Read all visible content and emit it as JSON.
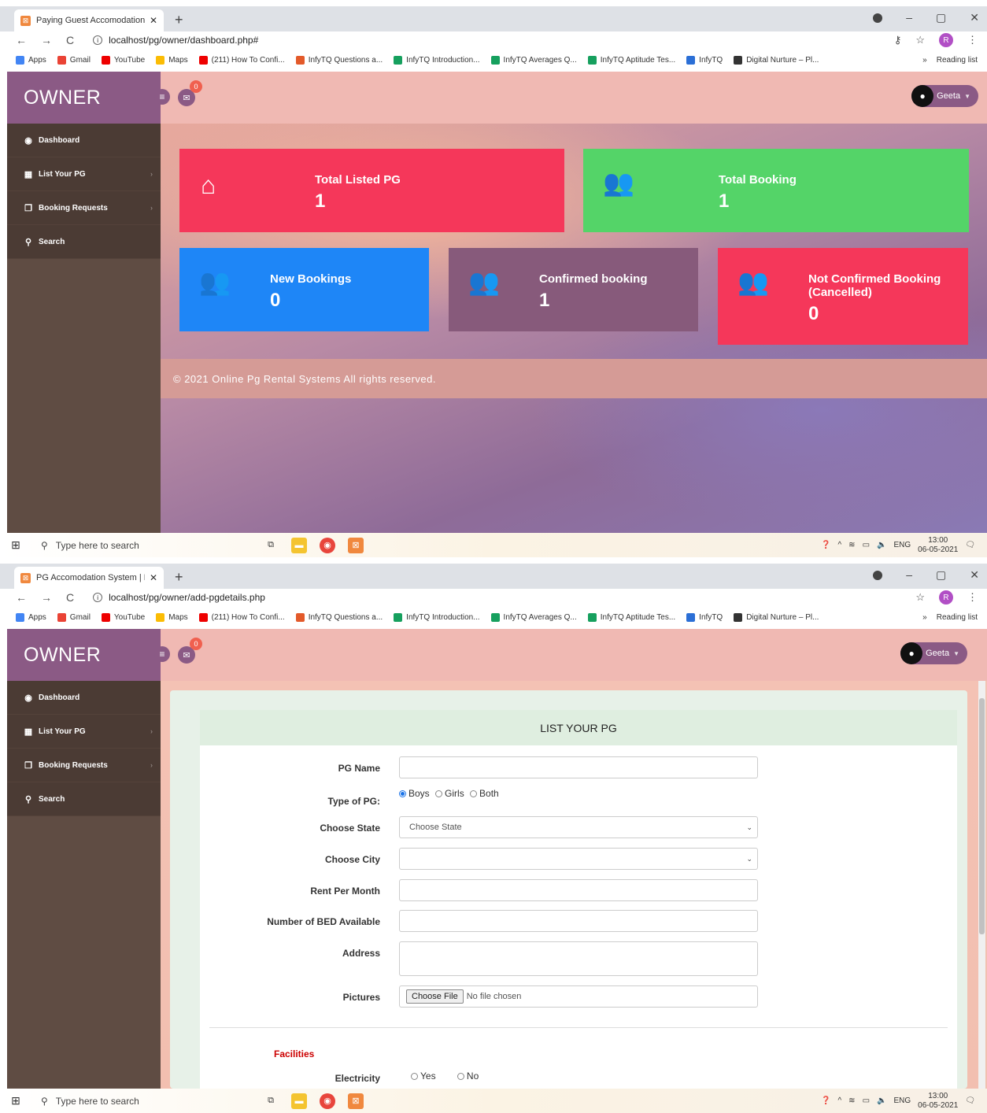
{
  "screens": [
    {
      "browser": {
        "tab_title": "Paying Guest Accomodation Syst",
        "url": "localhost/pg/owner/dashboard.php#"
      },
      "header": {
        "brand": "OWNER",
        "mail_count": "0",
        "user": "Geeta"
      },
      "cards": [
        {
          "title": "Total Listed PG",
          "value": "1",
          "color": "#f5375a",
          "icon": "home-icon"
        },
        {
          "title": "Total Booking",
          "value": "1",
          "color": "#54d468",
          "icon": "users-icon"
        },
        {
          "title": "New Bookings",
          "value": "0",
          "color": "#1e86f7",
          "icon": "users-icon"
        },
        {
          "title": "Confirmed booking",
          "value": "1",
          "color": "#875a7b",
          "icon": "users-icon"
        },
        {
          "title": "Not Confirmed Booking (Cancelled)",
          "value": "0",
          "color": "#f5375a",
          "icon": "users-icon"
        }
      ],
      "footer": "© 2021 Online Pg Rental Systems All rights reserved."
    },
    {
      "browser": {
        "tab_title": "PG Accomodation System | PG F",
        "url": "localhost/pg/owner/add-pgdetails.php"
      },
      "header": {
        "brand": "OWNER",
        "mail_count": "0",
        "user": "Geeta"
      },
      "form": {
        "title": "LIST YOUR PG",
        "pg_name_label": "PG Name",
        "type_label": "Type of PG:",
        "type_options": [
          "Boys",
          "Girls",
          "Both"
        ],
        "type_selected": "Boys",
        "state_label": "Choose State",
        "state_value": "Choose State",
        "city_label": "Choose City",
        "rent_label": "Rent Per Month",
        "beds_label": "Number of BED Available",
        "address_label": "Address",
        "pictures_label": "Pictures",
        "file_button": "Choose File",
        "file_status": "No file chosen",
        "facilities_heading": "Facilities",
        "electricity_label": "Electricity",
        "yes": "Yes",
        "no": "No"
      }
    }
  ],
  "sidebar": {
    "items": [
      {
        "label": "Dashboard",
        "icon": "dashboard-icon"
      },
      {
        "label": "List Your PG",
        "icon": "grid-icon"
      },
      {
        "label": "Booking Requests",
        "icon": "copy-icon"
      },
      {
        "label": "Search",
        "icon": "search-icon"
      }
    ]
  },
  "bookmarks": [
    "Apps",
    "Gmail",
    "YouTube",
    "Maps",
    "(211) How To Confi...",
    "InfyTQ Questions a...",
    "InfyTQ Introduction...",
    "InfyTQ Averages Q...",
    "InfyTQ Aptitude Tes...",
    "InfyTQ",
    "Digital Nurture – Pl..."
  ],
  "bookmarks_right": "Reading list",
  "profile_initial": "R",
  "taskbar": {
    "search": "Type here to search",
    "lang": "ENG",
    "time": "13:00",
    "date": "06-05-2021",
    "notif": "2"
  }
}
